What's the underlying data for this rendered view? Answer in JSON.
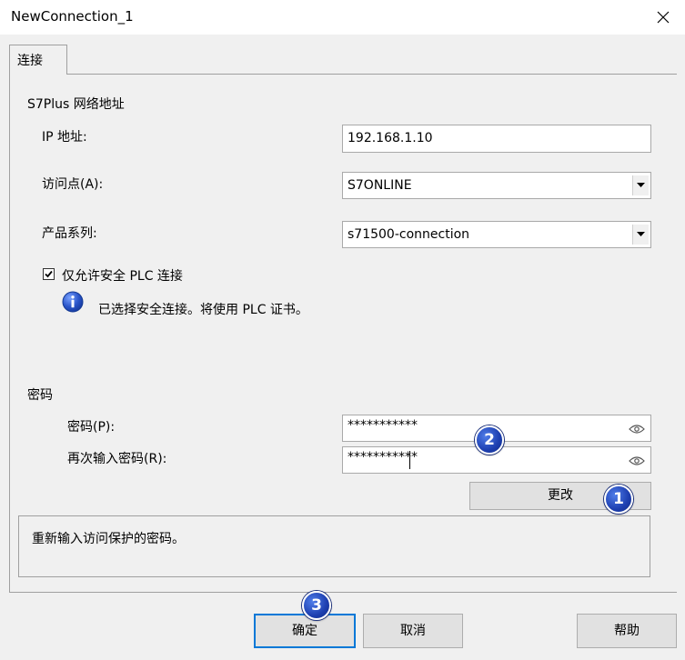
{
  "window": {
    "title": "NewConnection_1"
  },
  "tabs": [
    {
      "label": "连接"
    }
  ],
  "network": {
    "section_title": "S7Plus 网络地址",
    "ip_label": "IP 地址:",
    "ip_value": "192.168.1.10",
    "access_point_label": "访问点(A):",
    "access_point_value": "S7ONLINE",
    "product_family_label": "产品系列:",
    "product_family_value": "s71500-connection",
    "secure_only_label": "仅允许安全 PLC 连接",
    "secure_only_checked": true,
    "info_text": "已选择安全连接。将使用 PLC 证书。"
  },
  "password": {
    "section_title": "密码",
    "password_label": "密码(P):",
    "password_value": "***********",
    "reenter_label": "再次输入密码(R):",
    "reenter_value": "***********",
    "change_button": "更改"
  },
  "hint": {
    "text": "重新输入访问保护的密码。"
  },
  "buttons": {
    "ok": "确定",
    "cancel": "取消",
    "help": "帮助"
  },
  "badges": [
    {
      "label": "1"
    },
    {
      "label": "2"
    },
    {
      "label": "3"
    }
  ],
  "colors": {
    "badge_blue": "#1d3fb0",
    "focus_blue": "#0078d7"
  }
}
